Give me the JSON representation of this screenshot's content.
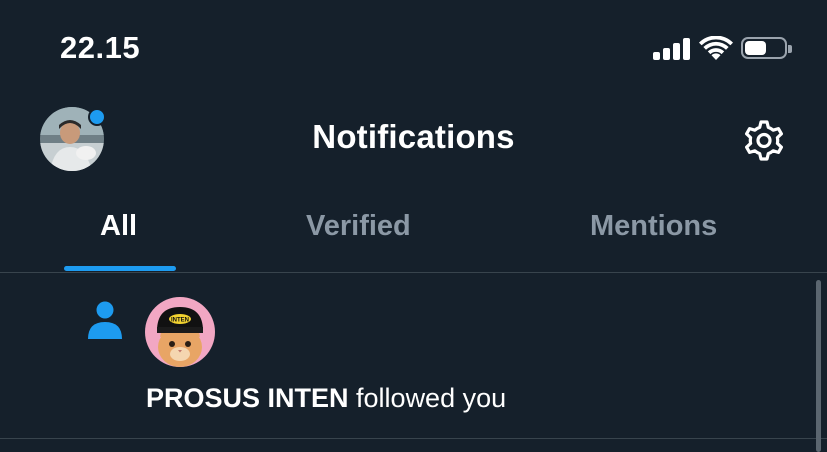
{
  "status_bar": {
    "time": "22.15",
    "battery_level": 0.55
  },
  "header": {
    "title": "Notifications",
    "avatar_icon": "profile-avatar",
    "settings_icon": "gear-icon",
    "has_unread_dot": true
  },
  "tabs": [
    {
      "label": "All",
      "active": true
    },
    {
      "label": "Verified",
      "active": false
    },
    {
      "label": "Mentions",
      "active": false
    }
  ],
  "notifications": [
    {
      "type": "follow",
      "icon": "person-icon",
      "user_name": "PROSUS INTEN",
      "action_text": " followed you",
      "avatar_cap_text": "INTEN"
    }
  ],
  "colors": {
    "background": "#15202b",
    "accent": "#1d9bf0",
    "muted_text": "#8b98a5",
    "divider": "#38444d"
  }
}
